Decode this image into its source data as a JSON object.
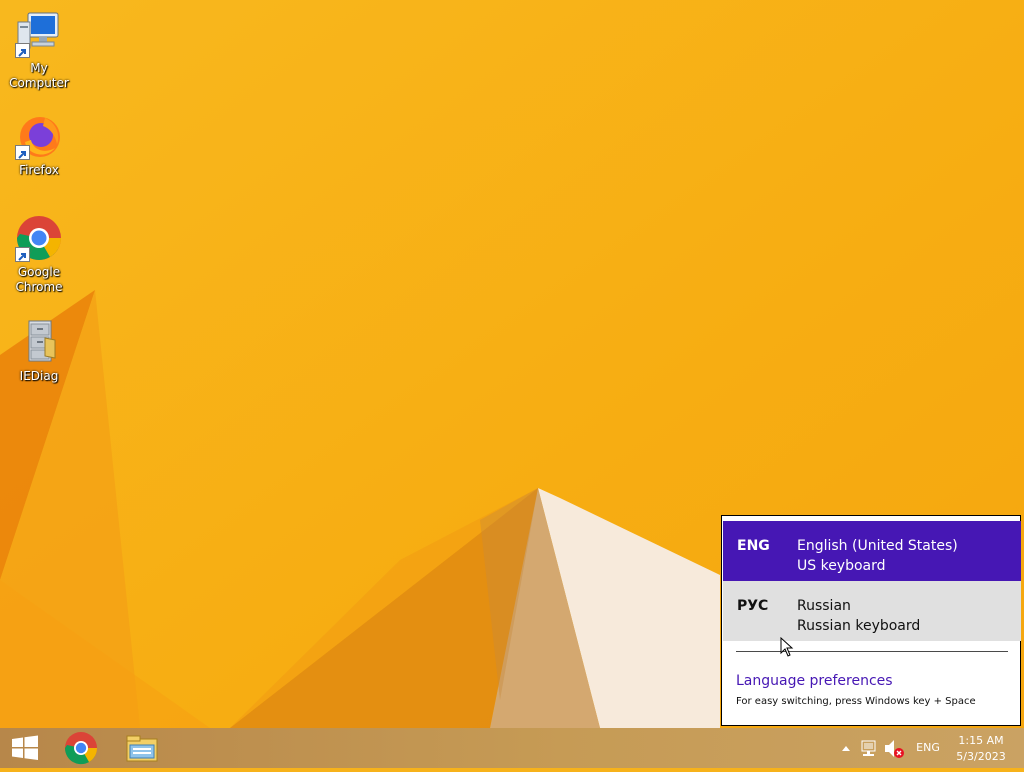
{
  "desktop_icons": [
    {
      "label": "My Computer",
      "icon": "computer-icon"
    },
    {
      "label": "Firefox",
      "icon": "firefox-icon"
    },
    {
      "label": "Google Chrome",
      "icon": "chrome-icon"
    },
    {
      "label": "IEDiag",
      "icon": "file-cabinet-icon"
    }
  ],
  "language_popup": {
    "languages": [
      {
        "code": "ENG",
        "name": "English (United States)",
        "keyboard": "US keyboard",
        "selected": true
      },
      {
        "code": "РУС",
        "name": "Russian",
        "keyboard": "Russian keyboard",
        "selected": false
      }
    ],
    "preferences_link": "Language preferences",
    "hint": "For easy switching, press Windows key + Space"
  },
  "taskbar": {
    "pinned": [
      "windows-start-icon",
      "chrome-icon",
      "file-explorer-icon"
    ],
    "tray": {
      "language": "ENG",
      "time": "1:15 AM",
      "date": "5/3/2023",
      "icons": [
        "show-hidden-icons-arrow",
        "network-icon",
        "volume-muted-icon"
      ]
    }
  },
  "colors": {
    "wallpaper": "#f7b21a",
    "accent": "#4617b4",
    "selected_row": "#4617b4",
    "hover_row": "#e0e0e0",
    "taskbar": "#b08a49"
  }
}
